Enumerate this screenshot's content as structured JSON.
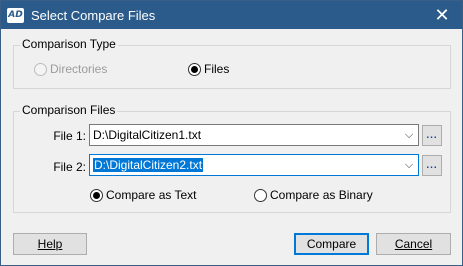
{
  "window": {
    "title": "Select Compare Files",
    "icon_text": "AD",
    "close_glyph": "✕"
  },
  "comparison_type": {
    "label": "Comparison Type",
    "options": [
      {
        "label": "Directories",
        "checked": false,
        "disabled": true
      },
      {
        "label": "Files",
        "checked": true,
        "disabled": false
      }
    ]
  },
  "comparison_files": {
    "label": "Comparison Files",
    "file1": {
      "label": "File 1:",
      "value": "D:\\DigitalCitizen1.txt"
    },
    "file2": {
      "label": "File 2:",
      "value": "D:\\DigitalCitizen2.txt"
    },
    "browse_label": "...",
    "dropdown_glyph": "⌵",
    "modes": [
      {
        "label": "Compare as Text",
        "checked": true
      },
      {
        "label": "Compare as Binary",
        "checked": false
      }
    ]
  },
  "buttons": {
    "help_label": "Help",
    "compare_label": "Compare",
    "cancel_label": "Cancel"
  }
}
